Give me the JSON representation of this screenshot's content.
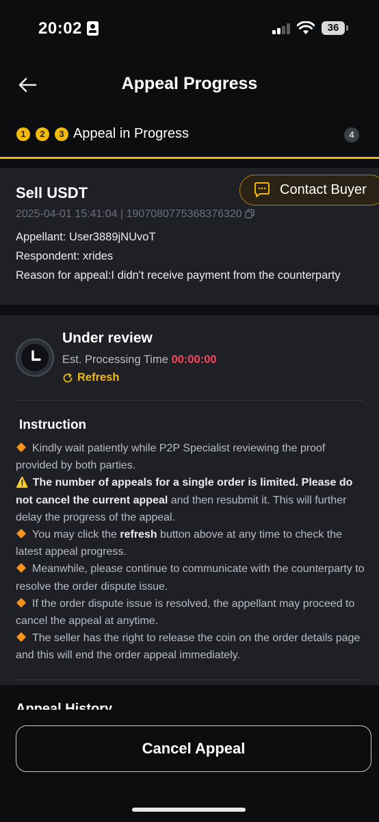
{
  "status_bar": {
    "time": "20:02",
    "battery": "36"
  },
  "header": {
    "title": "Appeal Progress"
  },
  "steps": {
    "completed": [
      "1",
      "2",
      "3"
    ],
    "current_label": "Appeal in Progress",
    "next": "4"
  },
  "order": {
    "title": "Sell USDT",
    "contact_label": "Contact Buyer",
    "meta": "2025-04-01 15:41:04 | 1907080775368376320",
    "appellant": "Appellant:  User3889jNUvoT",
    "respondent": "Respondent: xrides",
    "reason": "Reason for appeal:I didn't receive payment from the counterparty"
  },
  "review": {
    "title": "Under review",
    "est_label": "Est. Processing Time ",
    "est_time": "00:00:00",
    "refresh_label": "Refresh"
  },
  "instruction": {
    "title": "Instruction",
    "item1": "Kindly wait patiently while P2P Specialist reviewing the proof provided by both parties.",
    "item2_bold": "The number of appeals for a single order is limited. Please do not cancel the current appeal",
    "item2_rest": " and then resubmit it. This will further delay the progress of the appeal.",
    "item3_pre": "You may click the ",
    "item3_bold": "refresh",
    "item3_post": " button above at any time to check the latest appeal progress.",
    "item4": "Meanwhile, please continue to communicate with the counterparty to resolve the order dispute issue.",
    "item5": "If the order dispute issue is resolved, the appellant may proceed to cancel the appeal at anytime.",
    "item6": "The seller has the right to release the coin on the order details page and this will end the order appeal immediately."
  },
  "history": {
    "title": "Appeal History"
  },
  "footer": {
    "cancel_label": "Cancel Appeal"
  },
  "colors": {
    "accent": "#f0b90b",
    "danger": "#f6465d",
    "card": "#1e2026",
    "background": "#0c0d0f"
  },
  "icons": [
    "back-arrow-icon",
    "chat-icon",
    "copy-icon",
    "clock-icon",
    "refresh-icon",
    "diamond-icon",
    "warning-icon",
    "wifi-icon",
    "signal-icon",
    "battery-icon"
  ]
}
